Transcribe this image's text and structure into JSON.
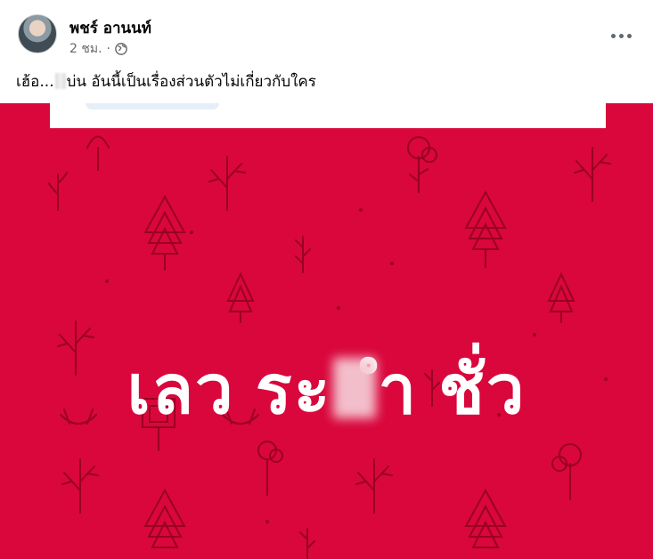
{
  "post": {
    "author_name": "พชร์ อานนท์",
    "time": "2 ชม.",
    "privacy_icon": "globe-icon",
    "caption_start": "เฮ้อ...",
    "caption_end": "บ่น อันนี้เป็นเรื่องส่วนตัวไม่เกี่ยวกับใคร",
    "more_icon": "more-options-icon"
  },
  "image": {
    "text_part1": "เลว ระ",
    "text_part2": "ำ ชั่ว",
    "background_color": "#d9073c",
    "text_color": "#ffffff"
  }
}
